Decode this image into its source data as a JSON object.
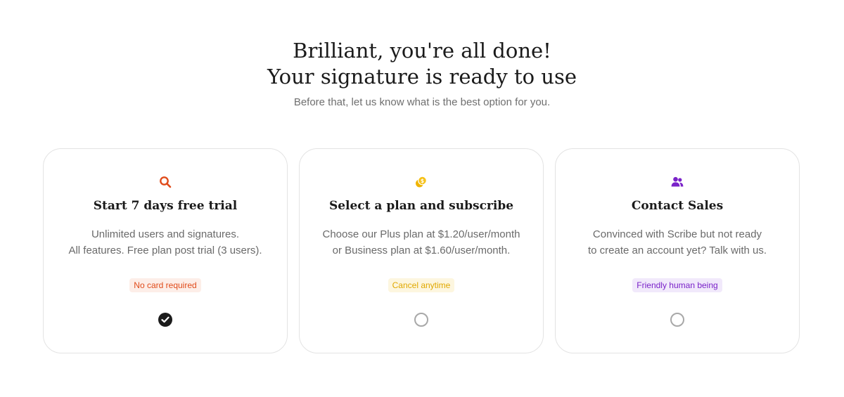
{
  "header": {
    "title_line1": "Brilliant, you're all done!",
    "title_line2": "Your signature is ready to use",
    "subtitle": "Before that, let us know what is the best option for you."
  },
  "colors": {
    "trial_accent": "#e04b1a",
    "plan_accent": "#f0b400",
    "sales_accent": "#7a22c9"
  },
  "cards": [
    {
      "icon": "search-icon",
      "title": "Start 7 days free trial",
      "desc_line1": "Unlimited users and signatures.",
      "desc_line2": "All features. Free plan post trial (3 users).",
      "badge": "No card required",
      "selected": true
    },
    {
      "icon": "coins-icon",
      "title": "Select a plan and subscribe",
      "desc_line1": "Choose our Plus plan at $1.20/user/month",
      "desc_line2": "or Business plan at $1.60/user/month.",
      "badge": "Cancel anytime",
      "selected": false
    },
    {
      "icon": "users-icon",
      "title": "Contact Sales",
      "desc_line1": "Convinced with Scribe but not ready",
      "desc_line2": "to create an account yet? Talk with us.",
      "badge": "Friendly human being",
      "selected": false
    }
  ]
}
